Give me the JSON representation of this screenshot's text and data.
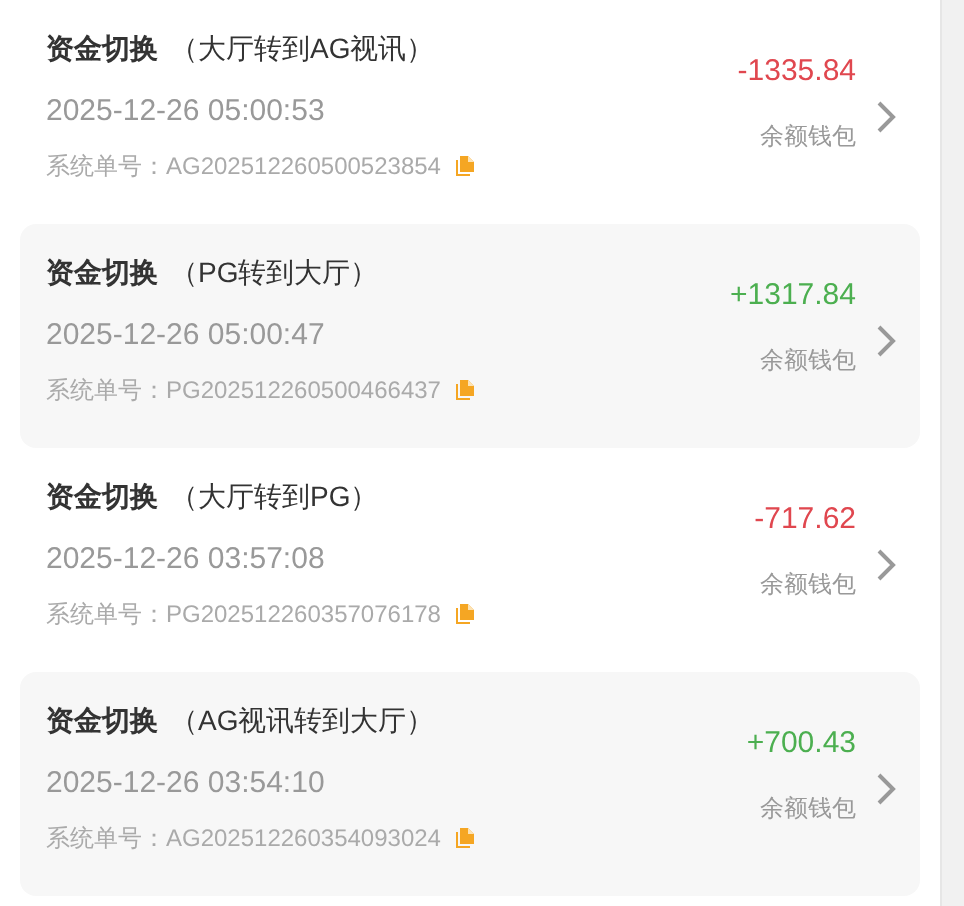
{
  "records": [
    {
      "type": "资金切换",
      "detail": "（大厅转到AG视讯）",
      "time": "2025-12-26 05:00:53",
      "order_label": "系统单号：",
      "order_no": "AG202512260500523854",
      "amount": "-1335.84",
      "kind": "debit",
      "wallet": "余额钱包"
    },
    {
      "type": "资金切换",
      "detail": "（PG转到大厅）",
      "time": "2025-12-26 05:00:47",
      "order_label": "系统单号：",
      "order_no": "PG202512260500466437",
      "amount": "+1317.84",
      "kind": "credit",
      "wallet": "余额钱包"
    },
    {
      "type": "资金切换",
      "detail": "（大厅转到PG）",
      "time": "2025-12-26 03:57:08",
      "order_label": "系统单号：",
      "order_no": "PG202512260357076178",
      "amount": "-717.62",
      "kind": "debit",
      "wallet": "余额钱包"
    },
    {
      "type": "资金切换",
      "detail": "（AG视讯转到大厅）",
      "time": "2025-12-26 03:54:10",
      "order_label": "系统单号：",
      "order_no": "AG202512260354093024",
      "amount": "+700.43",
      "kind": "credit",
      "wallet": "余额钱包"
    }
  ]
}
